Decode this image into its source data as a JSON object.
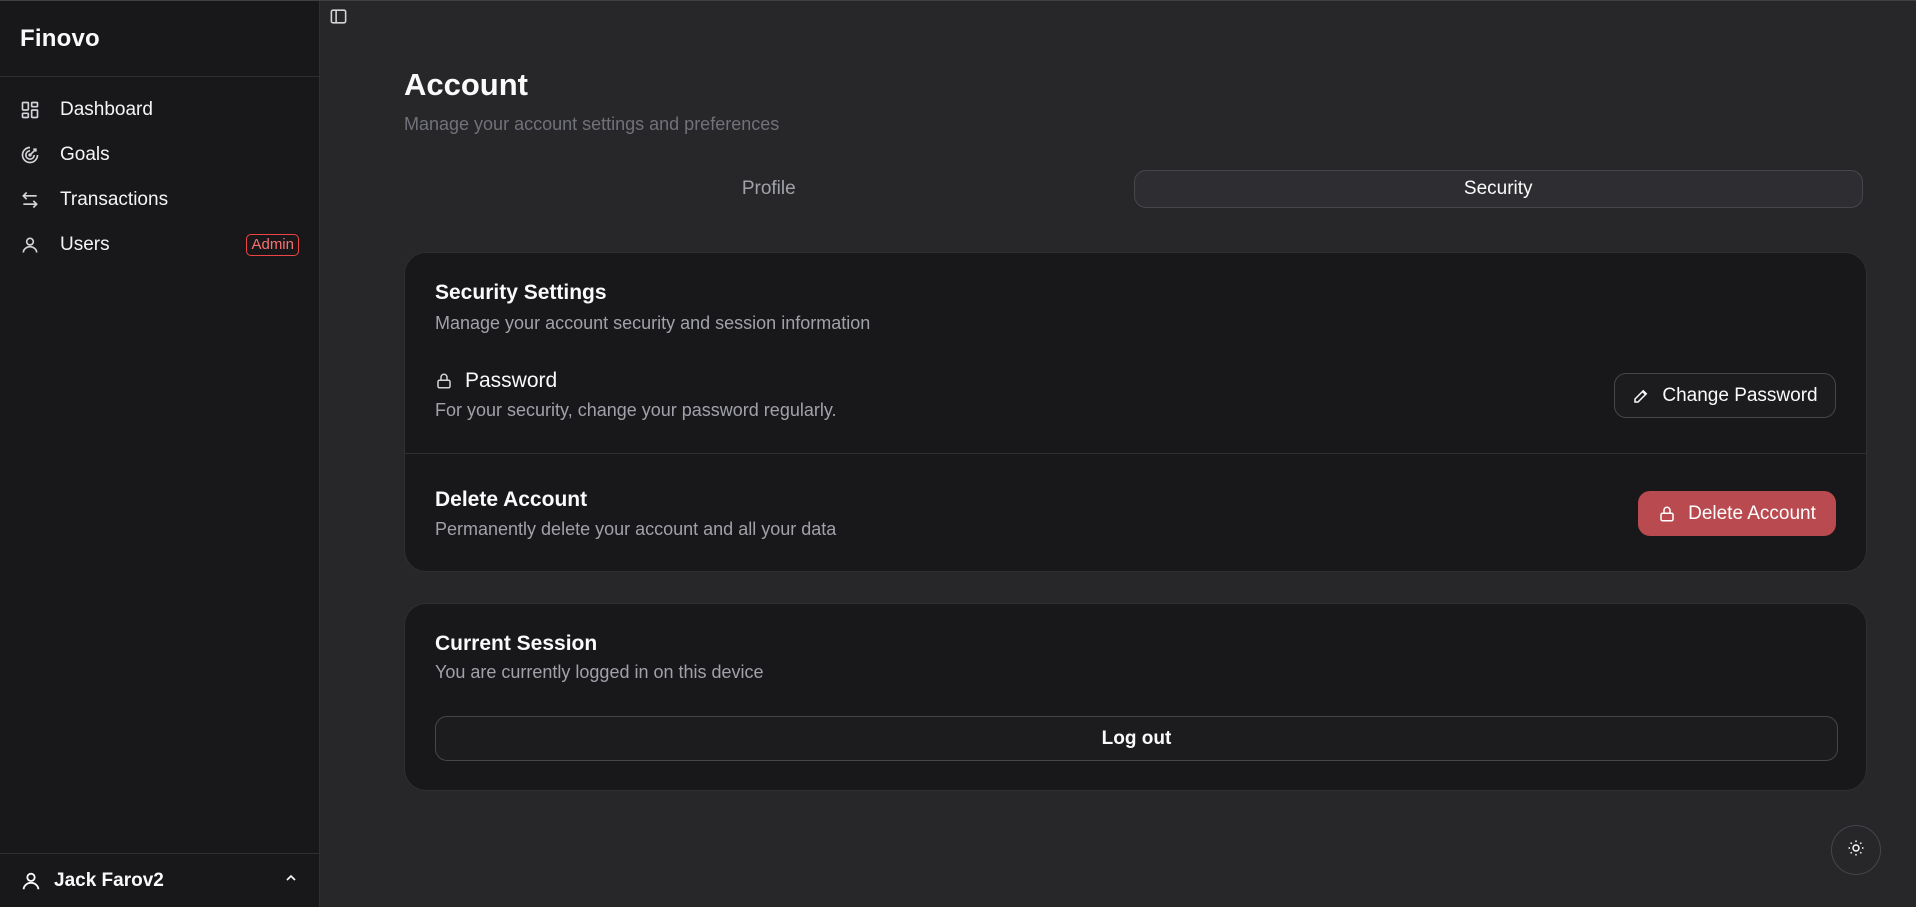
{
  "app": {
    "brand": "Finovo"
  },
  "sidebar": {
    "items": [
      {
        "label": "Dashboard",
        "icon": "dashboard-icon"
      },
      {
        "label": "Goals",
        "icon": "goals-icon"
      },
      {
        "label": "Transactions",
        "icon": "transactions-icon"
      },
      {
        "label": "Users",
        "icon": "user-icon",
        "badge": "Admin"
      }
    ],
    "user": {
      "name": "Jack Farov2"
    }
  },
  "page": {
    "title": "Account",
    "subtitle": "Manage your account settings and preferences"
  },
  "tabs": [
    {
      "label": "Profile",
      "active": false
    },
    {
      "label": "Security",
      "active": true
    }
  ],
  "security_card": {
    "title": "Security Settings",
    "description": "Manage your account security and session information",
    "password": {
      "title": "Password",
      "description": "For your security, change your password regularly.",
      "button": "Change Password"
    },
    "delete": {
      "title": "Delete Account",
      "description": "Permanently delete your account and all your data",
      "button": "Delete Account"
    }
  },
  "session_card": {
    "title": "Current Session",
    "description": "You are currently logged in on this device",
    "button": "Log out"
  },
  "colors": {
    "background": "#27272a",
    "sidebar": "#18181b",
    "card": "#18181b",
    "danger": "#b94a4f",
    "badge": "#ef4444"
  }
}
